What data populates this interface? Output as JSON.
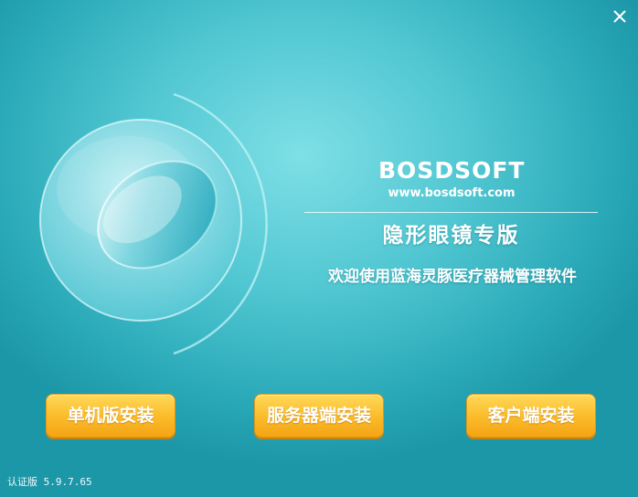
{
  "window": {
    "close_icon": "close-icon",
    "background_color": "#3fbccb"
  },
  "brand": {
    "logo_text": "BOSDSOFT",
    "url": "www.bosdsoft.com"
  },
  "edition_title": "隐形眼镜专版",
  "welcome_text": "欢迎使用蓝海灵豚医疗器械管理软件",
  "buttons": {
    "standalone": "单机版安装",
    "server": "服务器端安装",
    "client": "客户端安装",
    "color": "#fbbd2c"
  },
  "version": "认证版 5.9.7.65"
}
